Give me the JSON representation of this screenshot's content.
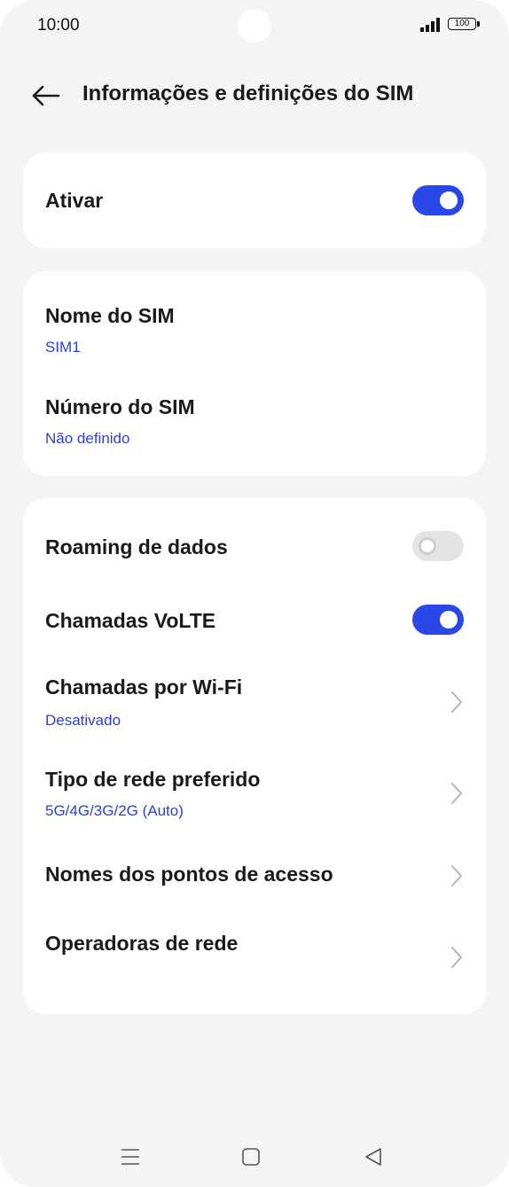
{
  "status_bar": {
    "time": "10:00",
    "battery": "100",
    "icons": [
      "signal-icon",
      "battery-icon"
    ]
  },
  "header": {
    "title": "Informações e definições do SIM",
    "back_icon": "arrow-left-icon"
  },
  "activate_card": {
    "label": "Ativar",
    "enabled": true
  },
  "sim_card": {
    "name_label": "Nome do SIM",
    "name_value": "SIM1",
    "number_label": "Número do SIM",
    "number_value": "Não definido"
  },
  "network_card": {
    "roaming": {
      "label": "Roaming de dados",
      "enabled": false
    },
    "volte": {
      "label": "Chamadas VoLTE",
      "enabled": true
    },
    "wifi_calling": {
      "label": "Chamadas por Wi-Fi",
      "value": "Desativado"
    },
    "network_type": {
      "label": "Tipo de rede preferido",
      "value": "5G/4G/3G/2G (Auto)"
    },
    "apn": {
      "label": "Nomes dos pontos de acesso"
    },
    "operators": {
      "label": "Operadoras de rede"
    }
  },
  "nav_bar": {
    "icons": [
      "menu-icon",
      "home-icon",
      "back-triangle-icon"
    ]
  },
  "colors": {
    "accent": "#2a47e8",
    "link": "#2a3fd6",
    "background": "#f4f4f4",
    "card": "#ffffff"
  }
}
